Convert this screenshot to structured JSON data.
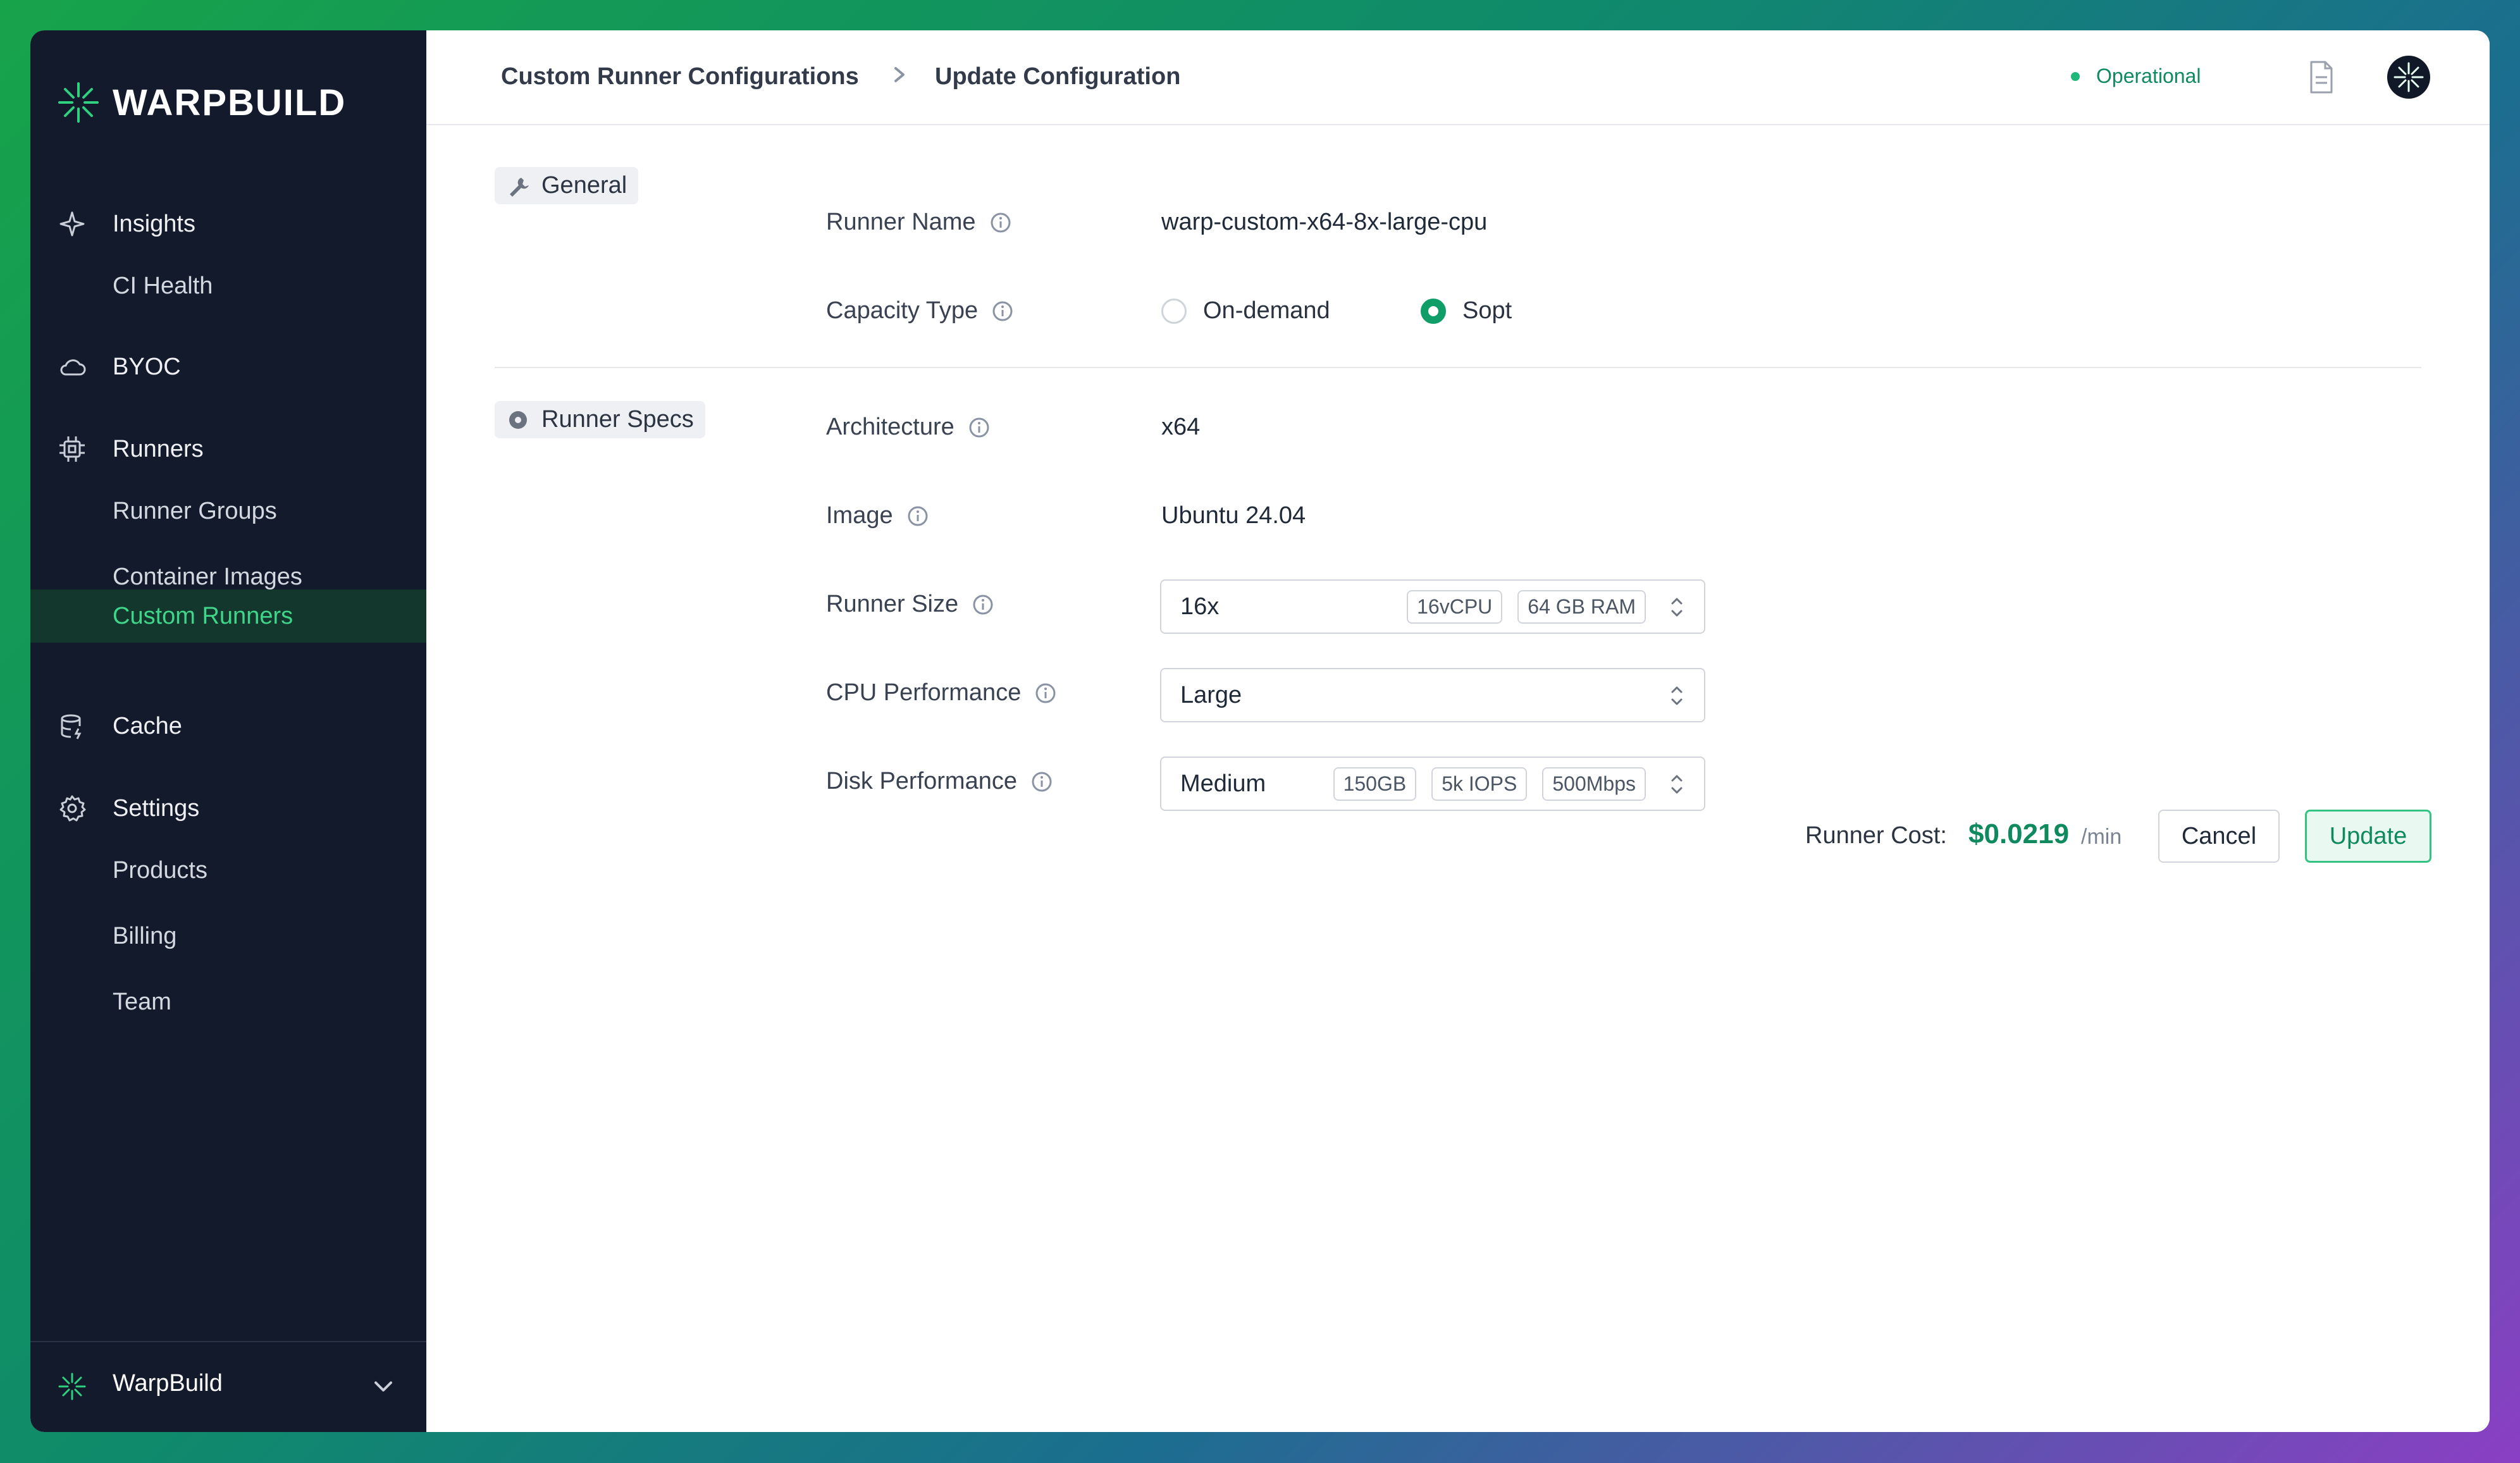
{
  "brand": {
    "name": "WARPBUILD",
    "accent": "#1fbf74",
    "sidebar_bg": "#121a2b"
  },
  "sidebar": {
    "items": [
      {
        "label": "Insights",
        "icon": "sparkle-icon",
        "sub": false
      },
      {
        "label": "CI Health",
        "sub": true
      },
      {
        "label": "BYOC",
        "icon": "cloud-icon",
        "sub": false
      },
      {
        "label": "Runners",
        "icon": "cpu-icon",
        "sub": false
      },
      {
        "label": "Runner Groups",
        "sub": true
      },
      {
        "label": "Container Images",
        "sub": true
      },
      {
        "label": "Custom Runners",
        "sub": true,
        "active": true
      },
      {
        "label": "Cache",
        "icon": "database-icon",
        "sub": false
      },
      {
        "label": "Settings",
        "icon": "gear-icon",
        "sub": false
      },
      {
        "label": "Products",
        "sub": true
      },
      {
        "label": "Billing",
        "sub": true
      },
      {
        "label": "Team",
        "sub": true
      }
    ],
    "org_switcher": {
      "label": "WarpBuild"
    }
  },
  "header": {
    "breadcrumb": [
      "Custom Runner Configurations",
      "Update Configuration"
    ],
    "status": "Operational"
  },
  "form": {
    "general_tag": "General",
    "specs_tag": "Runner Specs",
    "runner_name": {
      "label": "Runner Name",
      "value": "warp-custom-x64-8x-large-cpu"
    },
    "capacity_type": {
      "label": "Capacity Type",
      "options": [
        "On-demand",
        "Sopt"
      ],
      "selected": "Sopt"
    },
    "architecture": {
      "label": "Architecture",
      "value": "x64"
    },
    "image": {
      "label": "Image",
      "value": "Ubuntu 24.04"
    },
    "runner_size": {
      "label": "Runner Size",
      "value": "16x",
      "chips": [
        "16vCPU",
        "64 GB RAM"
      ]
    },
    "cpu_performance": {
      "label": "CPU Performance",
      "value": "Large"
    },
    "disk_performance": {
      "label": "Disk Performance",
      "value": "Medium",
      "chips": [
        "150GB",
        "5k IOPS",
        "500Mbps"
      ]
    }
  },
  "footer": {
    "cost_label": "Runner Cost:",
    "cost_value": "$0.0219",
    "cost_unit": "/min",
    "cancel_label": "Cancel",
    "update_label": "Update"
  }
}
